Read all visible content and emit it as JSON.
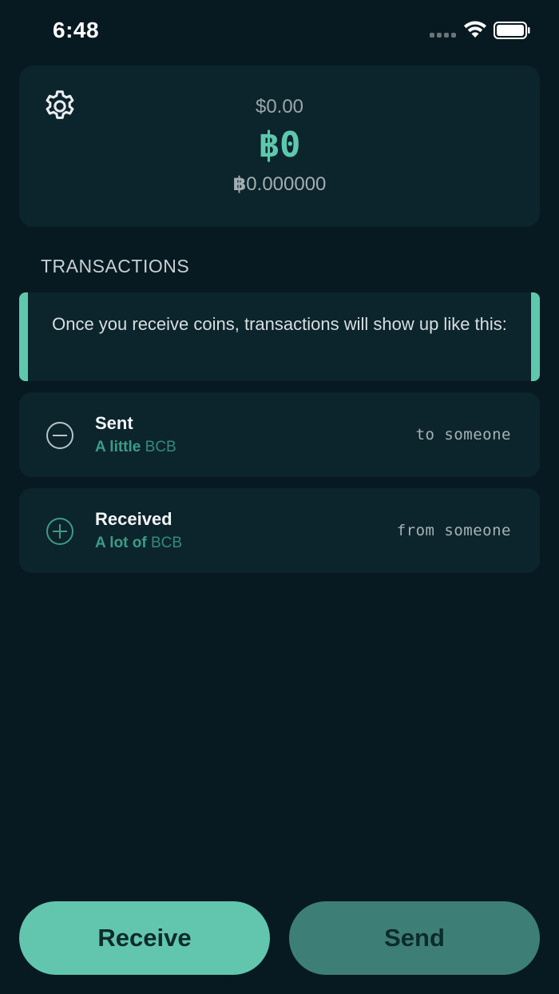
{
  "status_bar": {
    "time": "6:48"
  },
  "balance": {
    "fiat": "$0.00",
    "coin": "฿0",
    "coin_precise_symbol": "฿",
    "coin_precise_value": "0.000000"
  },
  "transactions": {
    "header": "TRANSACTIONS",
    "info_text": "Once you receive coins, transactions will show up like this:",
    "items": [
      {
        "title": "Sent",
        "amount_qty": "A little",
        "amount_unit": "BCB",
        "party": "to someone",
        "icon": "minus-circle-icon"
      },
      {
        "title": "Received",
        "amount_qty": "A lot of",
        "amount_unit": "BCB",
        "party": "from someone",
        "icon": "plus-circle-icon"
      }
    ]
  },
  "actions": {
    "receive_label": "Receive",
    "send_label": "Send"
  },
  "colors": {
    "background": "#081a21",
    "card": "#0c242c",
    "accent": "#5ec8ae",
    "send_button": "#3d7f76"
  }
}
